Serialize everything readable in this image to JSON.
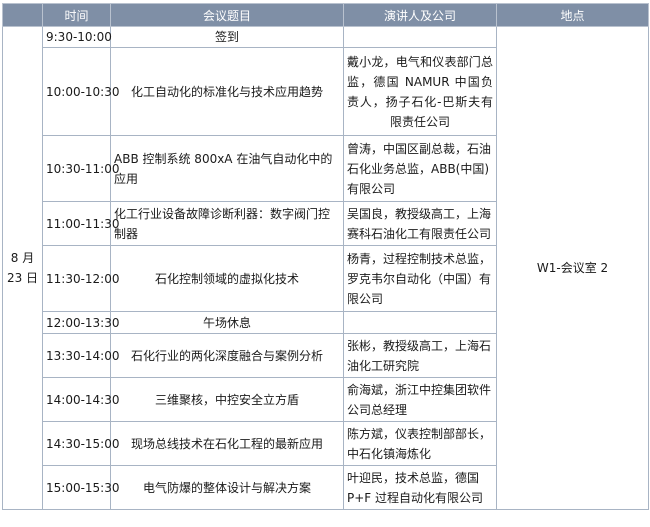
{
  "header": {
    "col_date": "",
    "col_time": "时间",
    "col_topic": "会议题目",
    "col_speaker": "演讲人及公司",
    "col_venue": "地点"
  },
  "date": "8 月 23 日",
  "venue": "W1-会议室 2",
  "rows": [
    {
      "time": "9:30-10:00",
      "topic": "签到",
      "speaker": ""
    },
    {
      "time": "10:00-10:30",
      "topic": "化工自动化的标准化与技术应用趋势",
      "speaker": "戴小龙，电气和仪表部门总监，德国 NAMUR 中国负责人，扬子石化-巴斯夫有限责任公司"
    },
    {
      "time": "10:30-11:00",
      "topic": "ABB 控制系统 800xA 在油气自动化中的应用",
      "speaker": "曾涛，中国区副总裁，石油石化业务总监，ABB(中国)有限公司"
    },
    {
      "time": "11:00-11:30",
      "topic": "化工行业设备故障诊断利器：数字阀门控制器",
      "speaker": "吴国良，教授级高工，上海赛科石油化工有限责任公司"
    },
    {
      "time": "11:30-12:00",
      "topic": "石化控制领域的虚拟化技术",
      "speaker": "杨青，过程控制技术总监，罗克韦尔自动化（中国）有限公司"
    },
    {
      "time": "12:00-13:30",
      "topic": "午场休息",
      "speaker": ""
    },
    {
      "time": "13:30-14:00",
      "topic": "石化行业的两化深度融合与案例分析",
      "speaker": "张彬，教授级高工，上海石油化工研究院"
    },
    {
      "time": "14:00-14:30",
      "topic": "三维聚核，中控安全立方盾",
      "speaker": "俞海斌，浙江中控集团软件公司总经理"
    },
    {
      "time": "14:30-15:00",
      "topic": "现场总线技术在石化工程的最新应用",
      "speaker": "陈方斌，仪表控制部部长，中石化镇海炼化"
    },
    {
      "time": "15:00-15:30",
      "topic": "电气防爆的整体设计与解决方案",
      "speaker": "叶迎民，技术总监，德国 P+F 过程自动化有限公司"
    }
  ]
}
